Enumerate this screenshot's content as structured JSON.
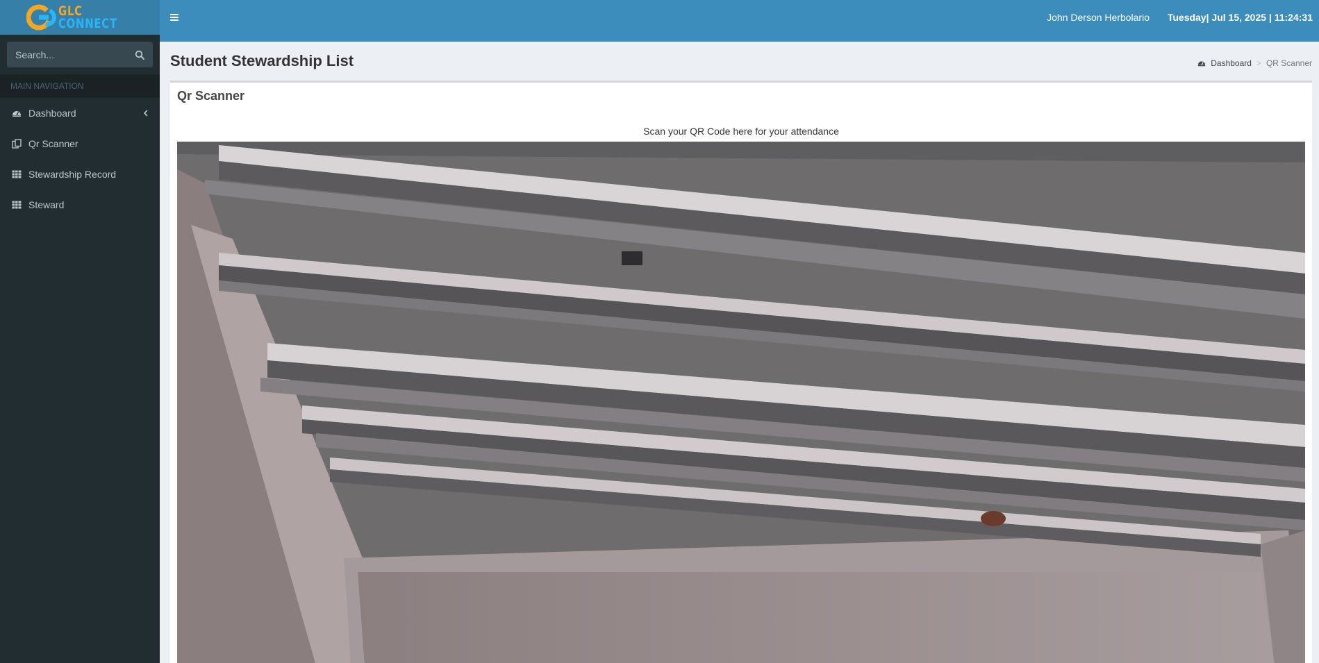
{
  "brand": {
    "line1": "GLC",
    "line2": "CONNECT",
    "colors": {
      "orange": "#f5a623",
      "blue": "#29b6f6"
    }
  },
  "sidebar": {
    "search_placeholder": "Search...",
    "nav_header": "MAIN NAVIGATION",
    "items": [
      {
        "label": "Dashboard",
        "icon": "dashboard-icon",
        "has_chevron": true
      },
      {
        "label": "Qr Scanner",
        "icon": "qr-scanner-icon"
      },
      {
        "label": "Stewardship Record",
        "icon": "table-grid-icon"
      },
      {
        "label": "Steward",
        "icon": "table-grid-icon"
      }
    ]
  },
  "header": {
    "user_name": "John Derson Herbolario",
    "datetime": "Tuesday| Jul 15, 2025 | 11:24:31"
  },
  "page": {
    "title": "Student Stewardship List",
    "breadcrumb": [
      "Dashboard",
      "QR Scanner"
    ]
  },
  "scanner": {
    "box_title": "Qr Scanner",
    "instruction": "Scan your QR Code here for your attendance",
    "feed": "live-camera-feed"
  },
  "colors": {
    "header_bg": "#3c8dbc",
    "logo_bg": "#367fa9",
    "sidebar_bg": "#222d32",
    "content_bg": "#ecf0f5"
  }
}
